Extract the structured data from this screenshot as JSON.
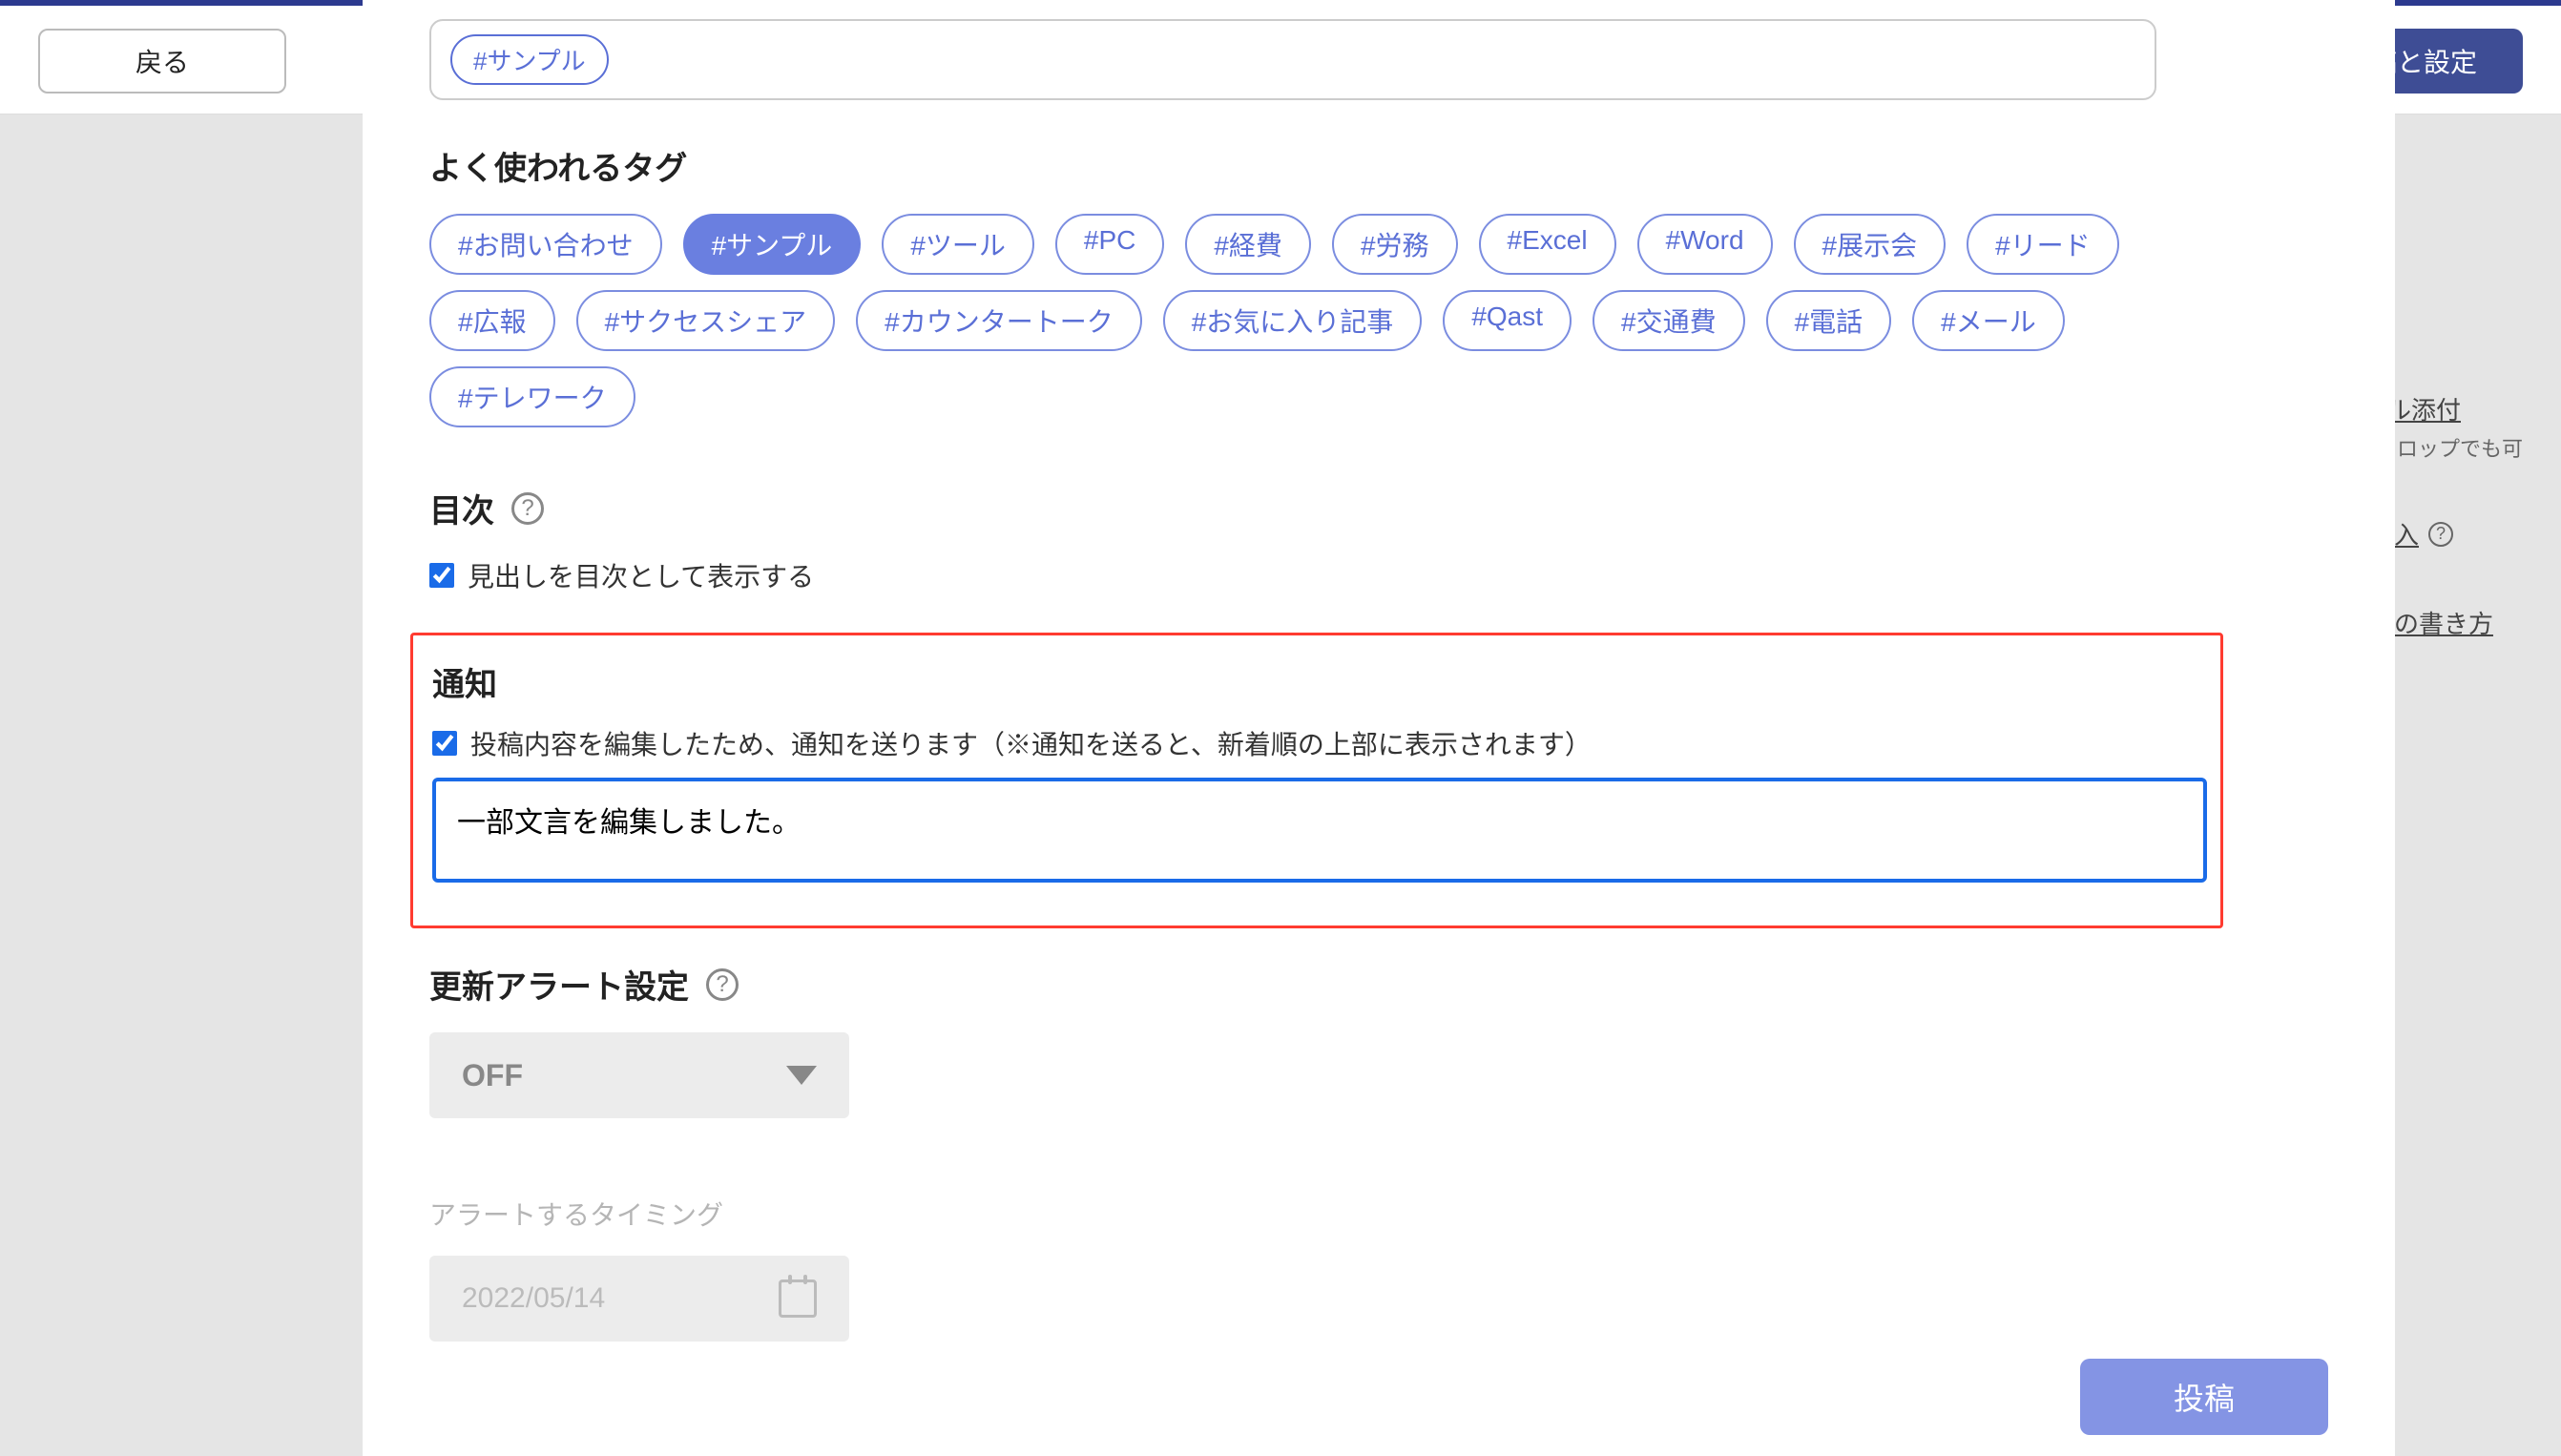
{
  "topbar": {
    "back_label": "戻る",
    "submit_settings_label": "投稿と設定"
  },
  "side_links": {
    "file_attach": "ファイル添付",
    "file_attach_hint": "※ドラッグ＆ドロップでも可",
    "insert_table": "表の挿入",
    "markdown_help": "Markdownの書き方"
  },
  "tag_input": {
    "current_tag": "#サンプル"
  },
  "sections": {
    "common_tags_heading": "よく使われるタグ",
    "toc_heading": "目次",
    "toc_checkbox_label": "見出しを目次として表示する",
    "notify_heading": "通知",
    "notify_checkbox_label": "投稿内容を編集したため、通知を送ります（※通知を送ると、新着順の上部に表示されます）",
    "notify_message_value": "一部文言を編集しました。",
    "alert_heading": "更新アラート設定",
    "alert_select_value": "OFF",
    "alert_timing_label": "アラートするタイミング",
    "alert_date_value": "2022/05/14"
  },
  "common_tags": [
    {
      "label": "#お問い合わせ",
      "selected": false
    },
    {
      "label": "#サンプル",
      "selected": true
    },
    {
      "label": "#ツール",
      "selected": false
    },
    {
      "label": "#PC",
      "selected": false
    },
    {
      "label": "#経費",
      "selected": false
    },
    {
      "label": "#労務",
      "selected": false
    },
    {
      "label": "#Excel",
      "selected": false
    },
    {
      "label": "#Word",
      "selected": false
    },
    {
      "label": "#展示会",
      "selected": false
    },
    {
      "label": "#リード",
      "selected": false
    },
    {
      "label": "#広報",
      "selected": false
    },
    {
      "label": "#サクセスシェア",
      "selected": false
    },
    {
      "label": "#カウンタートーク",
      "selected": false
    },
    {
      "label": "#お気に入り記事",
      "selected": false
    },
    {
      "label": "#Qast",
      "selected": false
    },
    {
      "label": "#交通費",
      "selected": false
    },
    {
      "label": "#電話",
      "selected": false
    },
    {
      "label": "#メール",
      "selected": false
    },
    {
      "label": "#テレワーク",
      "selected": false
    }
  ],
  "footer": {
    "submit_label": "投稿"
  }
}
